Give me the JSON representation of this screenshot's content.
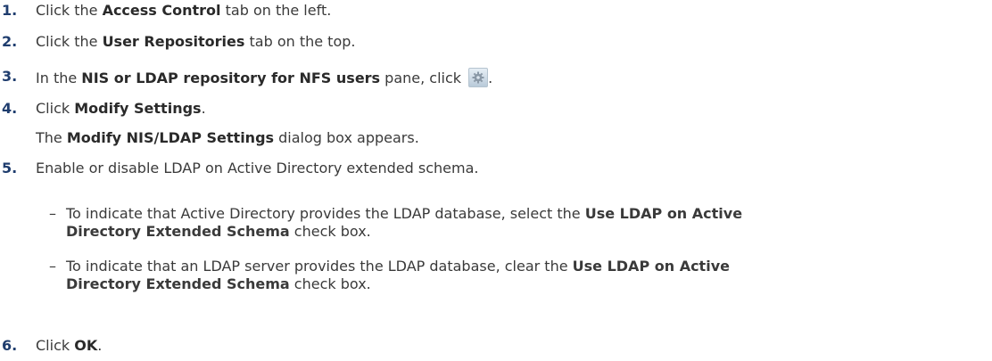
{
  "steps": [
    {
      "num": "1.",
      "pre": "Click the ",
      "bold": "Access Control",
      "post": " tab on the left."
    },
    {
      "num": "2.",
      "pre": "Click the ",
      "bold": "User Repositories",
      "post": " tab on the top."
    },
    {
      "num": "3.",
      "pre": "In the ",
      "bold": "NIS or LDAP repository for NFS users",
      "post": " pane, click ",
      "tail": ".",
      "icon": "settings-gear-icon"
    },
    {
      "num": "4.",
      "pre": "Click ",
      "bold": "Modify Settings",
      "post": "."
    },
    {
      "pre": "The ",
      "bold": "Modify NIS/LDAP Settings",
      "post": " dialog box appears."
    },
    {
      "num": "5.",
      "text": "Enable or disable LDAP on Active Directory extended schema."
    },
    {
      "num": "6.",
      "pre": "Click ",
      "bold": "OK",
      "post": "."
    }
  ],
  "substeps": [
    {
      "dash": "–",
      "line1_pre": "To indicate that Active Directory provides the LDAP database, select the ",
      "line1_bold": "Use LDAP on Active",
      "line2_bold": "Directory Extended Schema",
      "line2_post": " check box."
    },
    {
      "dash": "–",
      "line1_pre": "To indicate that an LDAP server provides the LDAP database, clear the ",
      "line1_bold": "Use LDAP on Active",
      "line2_bold": "Directory Extended Schema",
      "line2_post": " check box."
    }
  ]
}
